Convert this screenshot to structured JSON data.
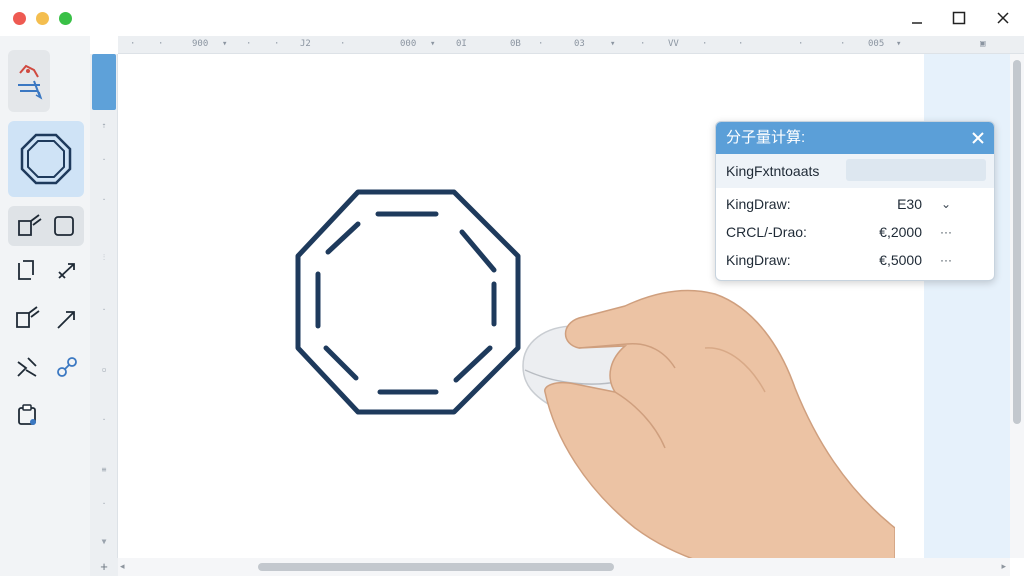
{
  "window": {
    "controls": [
      "minimize-icon",
      "maximize-icon",
      "close-icon"
    ]
  },
  "ruler": {
    "top_marks": [
      "900",
      "J2",
      "000",
      "0I",
      "0B",
      "03",
      "VV",
      "005"
    ]
  },
  "dialog": {
    "title": "分子量计算:",
    "header_label": "KingFxtntoaats",
    "header_value": "",
    "rows": [
      {
        "label": "KingDraw:",
        "value": "E30",
        "action": "⌄"
      },
      {
        "label": "CRCL/-Drao:",
        "value": "€,2000",
        "action": "···"
      },
      {
        "label": "KingDraw:",
        "value": "€,5000",
        "action": "···"
      }
    ]
  },
  "canvas": {
    "molecule": "cyclooctatetraene-octagon"
  },
  "colors": {
    "accent": "#5b9fd8",
    "bond": "#1e3a5c",
    "right_strip": "#e6f1fb"
  },
  "scroll": {
    "corner_label": "+"
  }
}
